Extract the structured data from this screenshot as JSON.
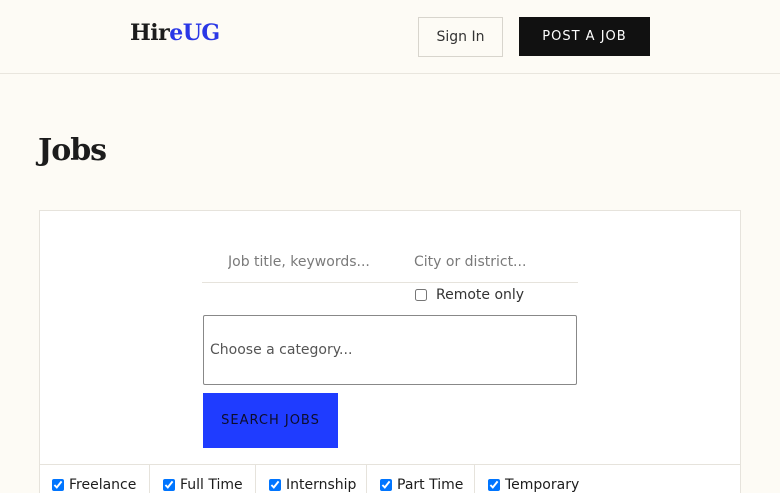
{
  "header": {
    "logo_part1": "Hir",
    "logo_part2": "eUG",
    "signin_label": "Sign In",
    "postjob_label": "POST A JOB"
  },
  "page": {
    "title": "Jobs"
  },
  "search": {
    "keywords_placeholder": "Job title, keywords...",
    "city_placeholder": "City or district...",
    "remote_label": "Remote only",
    "remote_checked": false,
    "category_placeholder": "Choose a category...",
    "submit_label": "SEARCH JOBS"
  },
  "job_types": [
    {
      "label": "Freelance",
      "checked": true
    },
    {
      "label": "Full Time",
      "checked": true
    },
    {
      "label": "Internship",
      "checked": true
    },
    {
      "label": "Part Time",
      "checked": true
    },
    {
      "label": "Temporary",
      "checked": true
    }
  ],
  "colors": {
    "brand_accent": "#2a37e6",
    "search_button": "#1f3cff",
    "post_job_button": "#111111"
  }
}
